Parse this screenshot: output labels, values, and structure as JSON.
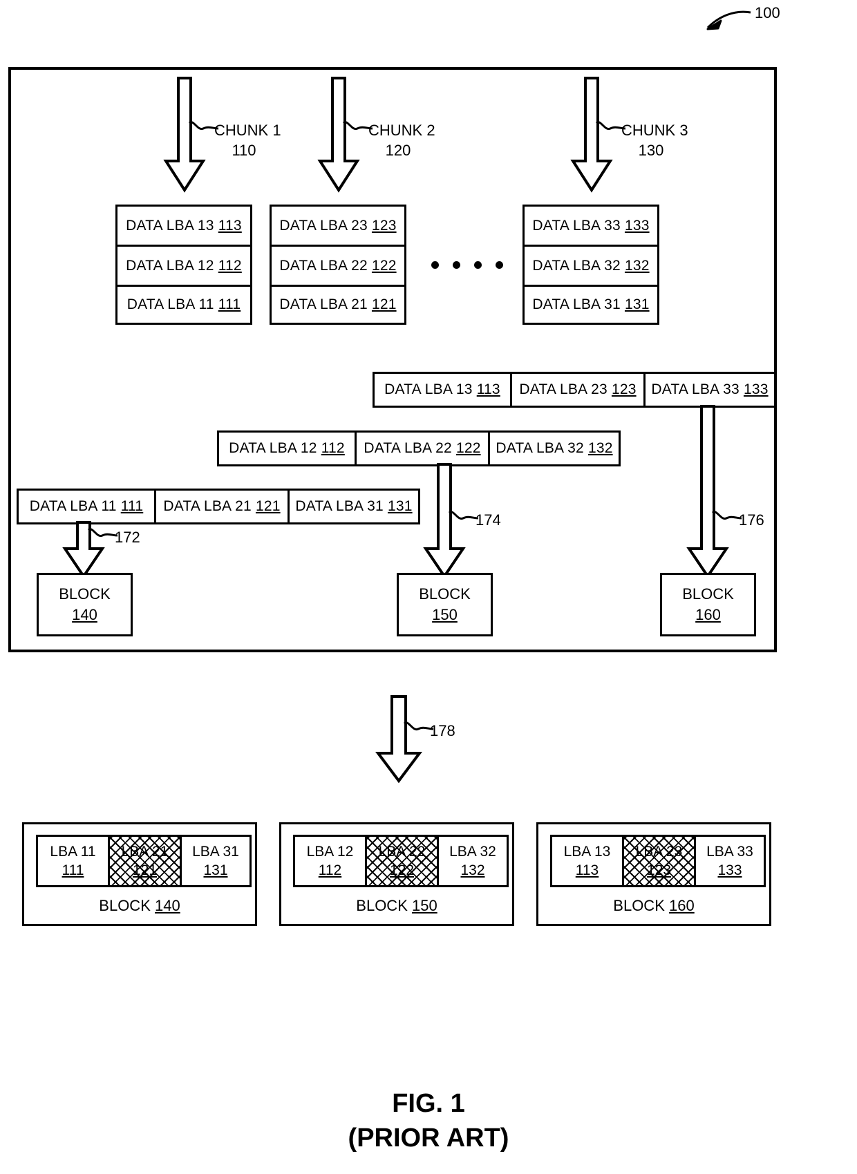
{
  "figure": {
    "reference_numeral": "100",
    "caption_line1": "FIG. 1",
    "caption_line2": "(PRIOR ART)"
  },
  "chunks": [
    {
      "title": "CHUNK 1",
      "number": "110",
      "rows": [
        {
          "label": "DATA LBA 13",
          "ref": "113"
        },
        {
          "label": "DATA LBA 12",
          "ref": "112"
        },
        {
          "label": "DATA LBA 11",
          "ref": "111"
        }
      ]
    },
    {
      "title": "CHUNK 2",
      "number": "120",
      "rows": [
        {
          "label": "DATA LBA 23",
          "ref": "123"
        },
        {
          "label": "DATA LBA 22",
          "ref": "122"
        },
        {
          "label": "DATA LBA 21",
          "ref": "121"
        }
      ]
    },
    {
      "title": "CHUNK 3",
      "number": "130",
      "rows": [
        {
          "label": "DATA LBA 33",
          "ref": "133"
        },
        {
          "label": "DATA LBA 32",
          "ref": "132"
        },
        {
          "label": "DATA LBA 31",
          "ref": "131"
        }
      ]
    }
  ],
  "ellipsis": "....",
  "stripes": [
    {
      "cells": [
        {
          "label": "DATA LBA 13",
          "ref": "113"
        },
        {
          "label": "DATA LBA 23",
          "ref": "123"
        },
        {
          "label": "DATA LBA 33",
          "ref": "133"
        }
      ]
    },
    {
      "cells": [
        {
          "label": "DATA LBA 12",
          "ref": "112"
        },
        {
          "label": "DATA LBA 22",
          "ref": "122"
        },
        {
          "label": "DATA LBA 32",
          "ref": "132"
        }
      ]
    },
    {
      "cells": [
        {
          "label": "DATA LBA 11",
          "ref": "111"
        },
        {
          "label": "DATA LBA 21",
          "ref": "121"
        },
        {
          "label": "DATA LBA 31",
          "ref": "131"
        }
      ]
    }
  ],
  "write_arrows": [
    {
      "callout": "172"
    },
    {
      "callout": "174"
    },
    {
      "callout": "176"
    }
  ],
  "mid_blocks": [
    {
      "label": "BLOCK",
      "number": "140"
    },
    {
      "label": "BLOCK",
      "number": "150"
    },
    {
      "label": "BLOCK",
      "number": "160"
    }
  ],
  "transition_arrow": {
    "callout": "178"
  },
  "result_blocks": [
    {
      "block_label": "BLOCK",
      "block_number": "140",
      "cells": [
        {
          "label": "LBA 11",
          "ref": "111",
          "hatched": false
        },
        {
          "label": "LBA 21",
          "ref": "121",
          "hatched": true
        },
        {
          "label": "LBA 31",
          "ref": "131",
          "hatched": false
        }
      ]
    },
    {
      "block_label": "BLOCK",
      "block_number": "150",
      "cells": [
        {
          "label": "LBA 12",
          "ref": "112",
          "hatched": false
        },
        {
          "label": "LBA 22",
          "ref": "122",
          "hatched": true
        },
        {
          "label": "LBA 32",
          "ref": "132",
          "hatched": false
        }
      ]
    },
    {
      "block_label": "BLOCK",
      "block_number": "160",
      "cells": [
        {
          "label": "LBA 13",
          "ref": "113",
          "hatched": false
        },
        {
          "label": "LBA 23",
          "ref": "123",
          "hatched": true
        },
        {
          "label": "LBA 33",
          "ref": "133",
          "hatched": false
        }
      ]
    }
  ]
}
